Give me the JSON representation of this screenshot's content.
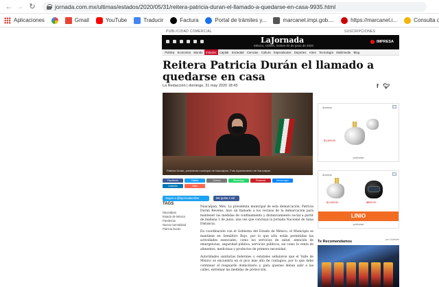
{
  "browser": {
    "url": "jornada.com.mx/ultimas/estados/2020/05/31/reitera-patricia-duran-el-llamado-a-quedarse-en-casa-9935.html",
    "bookmarks": [
      {
        "label": "Aplicaciones",
        "icon": "apps-grid-icon"
      },
      {
        "label": "",
        "icon": "google-icon"
      },
      {
        "label": "Gmail",
        "icon": "gmail-icon"
      },
      {
        "label": "YouTube",
        "icon": "youtube-icon"
      },
      {
        "label": "Traducir",
        "icon": "translate-icon"
      },
      {
        "label": "Factura",
        "icon": "factura-icon"
      },
      {
        "label": "Portal de trámites y...",
        "icon": "portal-icon"
      },
      {
        "label": "marcanet.impi.gob....",
        "icon": "marcanet-icon"
      },
      {
        "label": "https://marcanet.i...",
        "icon": "marcanet-icon"
      },
      {
        "label": "Consulta de IMEI |...",
        "icon": "imei-icon"
      }
    ]
  },
  "site": {
    "top_left": "PUBLICIDAD COMERCIAL",
    "top_right": "SUSCRIPCIONES",
    "logo": "LaJornada",
    "date_line": "México, CDMX, martes 02 de junio de 2020",
    "impresa": "IMPRESA",
    "nav": [
      "Política",
      "Economía",
      "Mundo",
      "Estados",
      "Capital",
      "Sociedad",
      "Ciencias",
      "Cultura",
      "Espectáculos",
      "Deportes",
      "Artes",
      "Tecnología",
      "Multimedia",
      "Blog"
    ],
    "nav_active": "Estados",
    "accent": "#c8102e"
  },
  "article": {
    "headline": "Reitera Patricia Durán el llamado a quedarse en casa",
    "byline": "La Redacción | domingo, 31 may 2020 18:43",
    "photo_caption": "Patricia Durán, presidenta municipal de Naucalpan. Foto Ayuntamiento de Naucalpan",
    "share_buttons": [
      {
        "label": "Facebook",
        "color": "#3b5998"
      },
      {
        "label": "Twitter",
        "color": "#1da1f2"
      },
      {
        "label": "Correo",
        "color": "#777777"
      },
      {
        "label": "WhatsApp",
        "color": "#25d366"
      },
      {
        "label": "Pinterest",
        "color": "#cb2027"
      },
      {
        "label": "Messenger",
        "color": "#0084ff"
      },
      {
        "label": "LinkedIn",
        "color": "#0077b5"
      },
      {
        "label": "Más",
        "color": "#ff6550"
      }
    ],
    "follow_twitter": "Seguir a @lajornadaonline",
    "facebook_like": "Me gusta 4 mil",
    "tags_title": "TAGS",
    "tags": [
      "Naucalpan",
      "Estado de México",
      "Pandemia",
      "Nueva normalidad",
      "Patricia Durán"
    ],
    "paragraphs": [
      "Naucalpan, Méx. La presidenta municipal de esta demarcación, Patricia Durán Reveles, hizo un llamado a los vecinos de la demarcación para mantener las medidas de confinamiento y distanciamiento social a partir de mañana 1 de junio, una vez que concluya la Jornada Nacional de Sana Distancia.",
      "En coordinación con el Gobierno del Estado de México, el Municipio se mantiene en Semáforo Rojo, por lo que sólo están permitidas las actividades esenciales, como los servicios de salud, atención de emergencias, seguridad pública, servicios públicos, así como la venta de alimentos, medicinas y productos de primera necesidad.",
      "Autoridades sanitarias federales y estatales señalaron que el Valle de México se encuentra en el pico más alto de contagios, por lo que debe continuar el resguardo domiciliario y, para quienes deban salir a las calles, extremar las medidas de protección."
    ]
  },
  "ads": {
    "ad1": {
      "label": "Anuncio",
      "price": "$1,499.00",
      "footer": "publicidad"
    },
    "ad2": {
      "label": "Anuncio",
      "price_left": "$1,499.00",
      "price_right": "$899.00",
      "brand": "LINIO",
      "footer": "publicidad"
    }
  },
  "recommended": {
    "title": "Te Recomendamos",
    "by": "por Outbrain"
  }
}
